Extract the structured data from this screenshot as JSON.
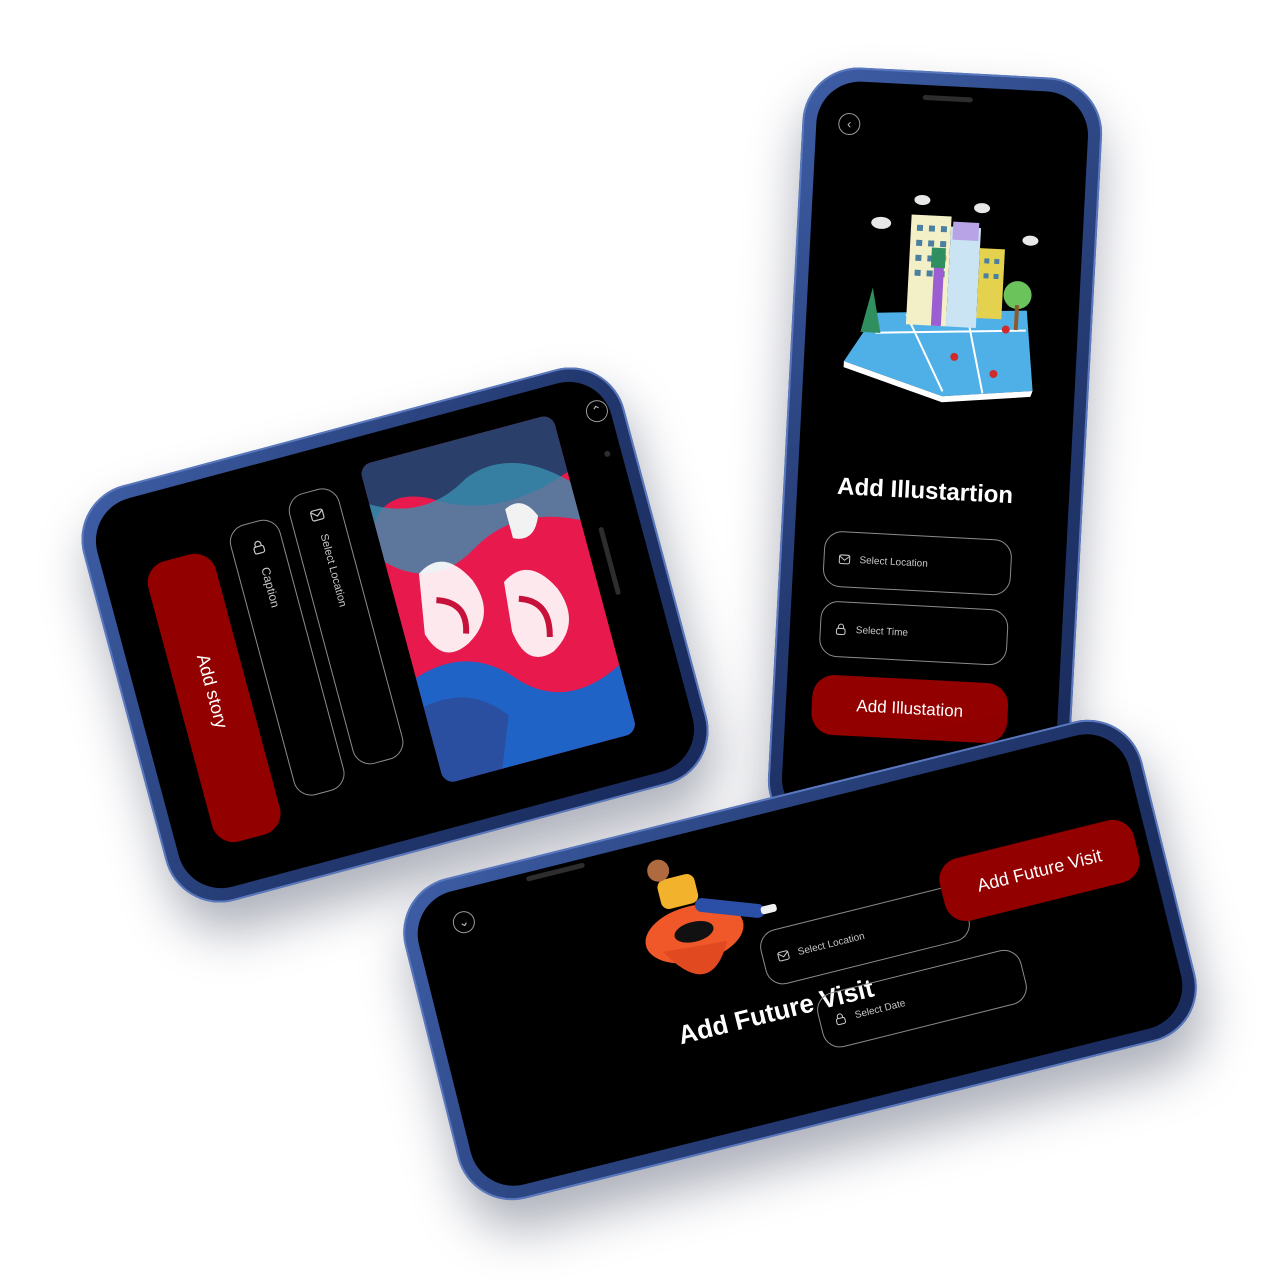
{
  "phone_story": {
    "back_icon": "chevron-up-icon",
    "fields": [
      {
        "label": "Select Location",
        "icon": "envelope-icon"
      },
      {
        "label": "Caption",
        "icon": "lock-icon"
      }
    ],
    "button_label": "Add story"
  },
  "phone_illustration": {
    "back_icon": "chevron-left-icon",
    "title": "Add Illustartion",
    "fields": [
      {
        "label": "Select Location",
        "icon": "envelope-icon"
      },
      {
        "label": "Select Time",
        "icon": "lock-icon"
      }
    ],
    "button_label": "Add Illustation"
  },
  "phone_future": {
    "back_icon": "chevron-down-icon",
    "title": "Add Future Visit",
    "fields": [
      {
        "label": "Select Location",
        "icon": "envelope-icon"
      },
      {
        "label": "Select Date",
        "icon": "lock-icon"
      }
    ],
    "button_label": "Add Future Visit"
  },
  "colors": {
    "accent": "#920000",
    "frame": "#2a4585",
    "screen": "#000000"
  }
}
